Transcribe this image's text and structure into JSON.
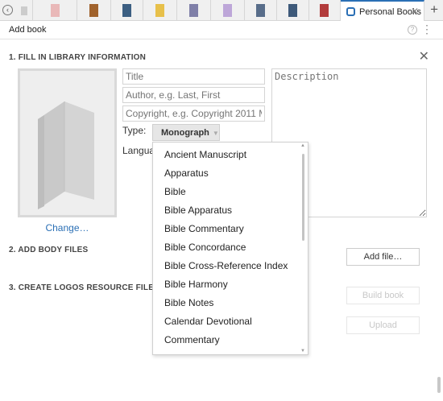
{
  "tabs": {
    "active_label": "Personal Books",
    "thumbnail_colors": [
      "#cccccc",
      "#e9b8b8",
      "#a0622c",
      "#3c5f82",
      "#e7c04a",
      "#7f7fa8",
      "#bda6d8",
      "#586d8a",
      "#3e5a7a",
      "#b23b3b"
    ]
  },
  "toolbar": {
    "title": "Add book"
  },
  "sections": {
    "library_info": "1. FILL IN LIBRARY INFORMATION",
    "body_files": "2. ADD BODY FILES",
    "create_resource": "3. CREATE LOGOS RESOURCE FILE"
  },
  "form": {
    "title_placeholder": "Title",
    "author_placeholder": "Author, e.g. Last, First",
    "copyright_placeholder": "Copyright, e.g. Copyright 2011 M",
    "description_placeholder": "Description",
    "type_label": "Type:",
    "type_value": "Monograph",
    "language_label": "Langua",
    "change_link": "Change…"
  },
  "buttons": {
    "add_file": "Add file…",
    "build_book": "Build book",
    "upload": "Upload"
  },
  "dropdown": {
    "items": [
      "Ancient Manuscript",
      "Apparatus",
      "Bible",
      "Bible Apparatus",
      "Bible Commentary",
      "Bible Concordance",
      "Bible Cross-Reference Index",
      "Bible Harmony",
      "Bible Notes",
      "Calendar Devotional",
      "Commentary"
    ]
  },
  "colors": {
    "accent": "#2a6fb5"
  }
}
